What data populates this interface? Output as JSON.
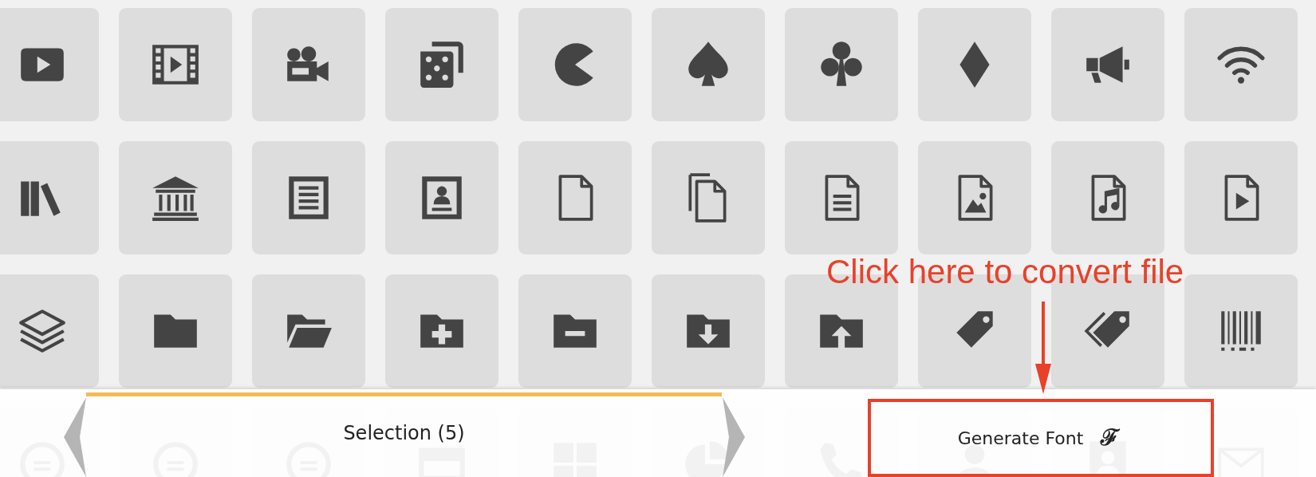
{
  "icon_grid": [
    {
      "kind": "play"
    },
    {
      "kind": "film"
    },
    {
      "kind": "camera"
    },
    {
      "kind": "dice"
    },
    {
      "kind": "pacman"
    },
    {
      "kind": "spade"
    },
    {
      "kind": "club"
    },
    {
      "kind": "diamond"
    },
    {
      "kind": "bullhorn"
    },
    {
      "kind": "wifi"
    },
    {
      "kind": "books"
    },
    {
      "kind": "library"
    },
    {
      "kind": "newspaper"
    },
    {
      "kind": "profile"
    },
    {
      "kind": "file"
    },
    {
      "kind": "files"
    },
    {
      "kind": "file-text"
    },
    {
      "kind": "file-picture"
    },
    {
      "kind": "file-music"
    },
    {
      "kind": "file-play"
    },
    {
      "kind": "stack"
    },
    {
      "kind": "folder"
    },
    {
      "kind": "folder-open"
    },
    {
      "kind": "folder-plus"
    },
    {
      "kind": "folder-minus"
    },
    {
      "kind": "folder-download"
    },
    {
      "kind": "folder-upload"
    },
    {
      "kind": "tag"
    },
    {
      "kind": "tags"
    },
    {
      "kind": "barcode"
    },
    {
      "kind": "coin"
    },
    {
      "kind": "coin"
    },
    {
      "kind": "coin"
    },
    {
      "kind": "card"
    },
    {
      "kind": "calculator"
    },
    {
      "kind": "pie"
    },
    {
      "kind": "phone"
    },
    {
      "kind": "user"
    },
    {
      "kind": "contact"
    },
    {
      "kind": "envelope"
    }
  ],
  "selection_bar": {
    "label": "Selection (5)"
  },
  "generate_button": {
    "label": "Generate Font",
    "icon": "ℱ"
  },
  "annotation": {
    "text": "Click here to convert file"
  }
}
